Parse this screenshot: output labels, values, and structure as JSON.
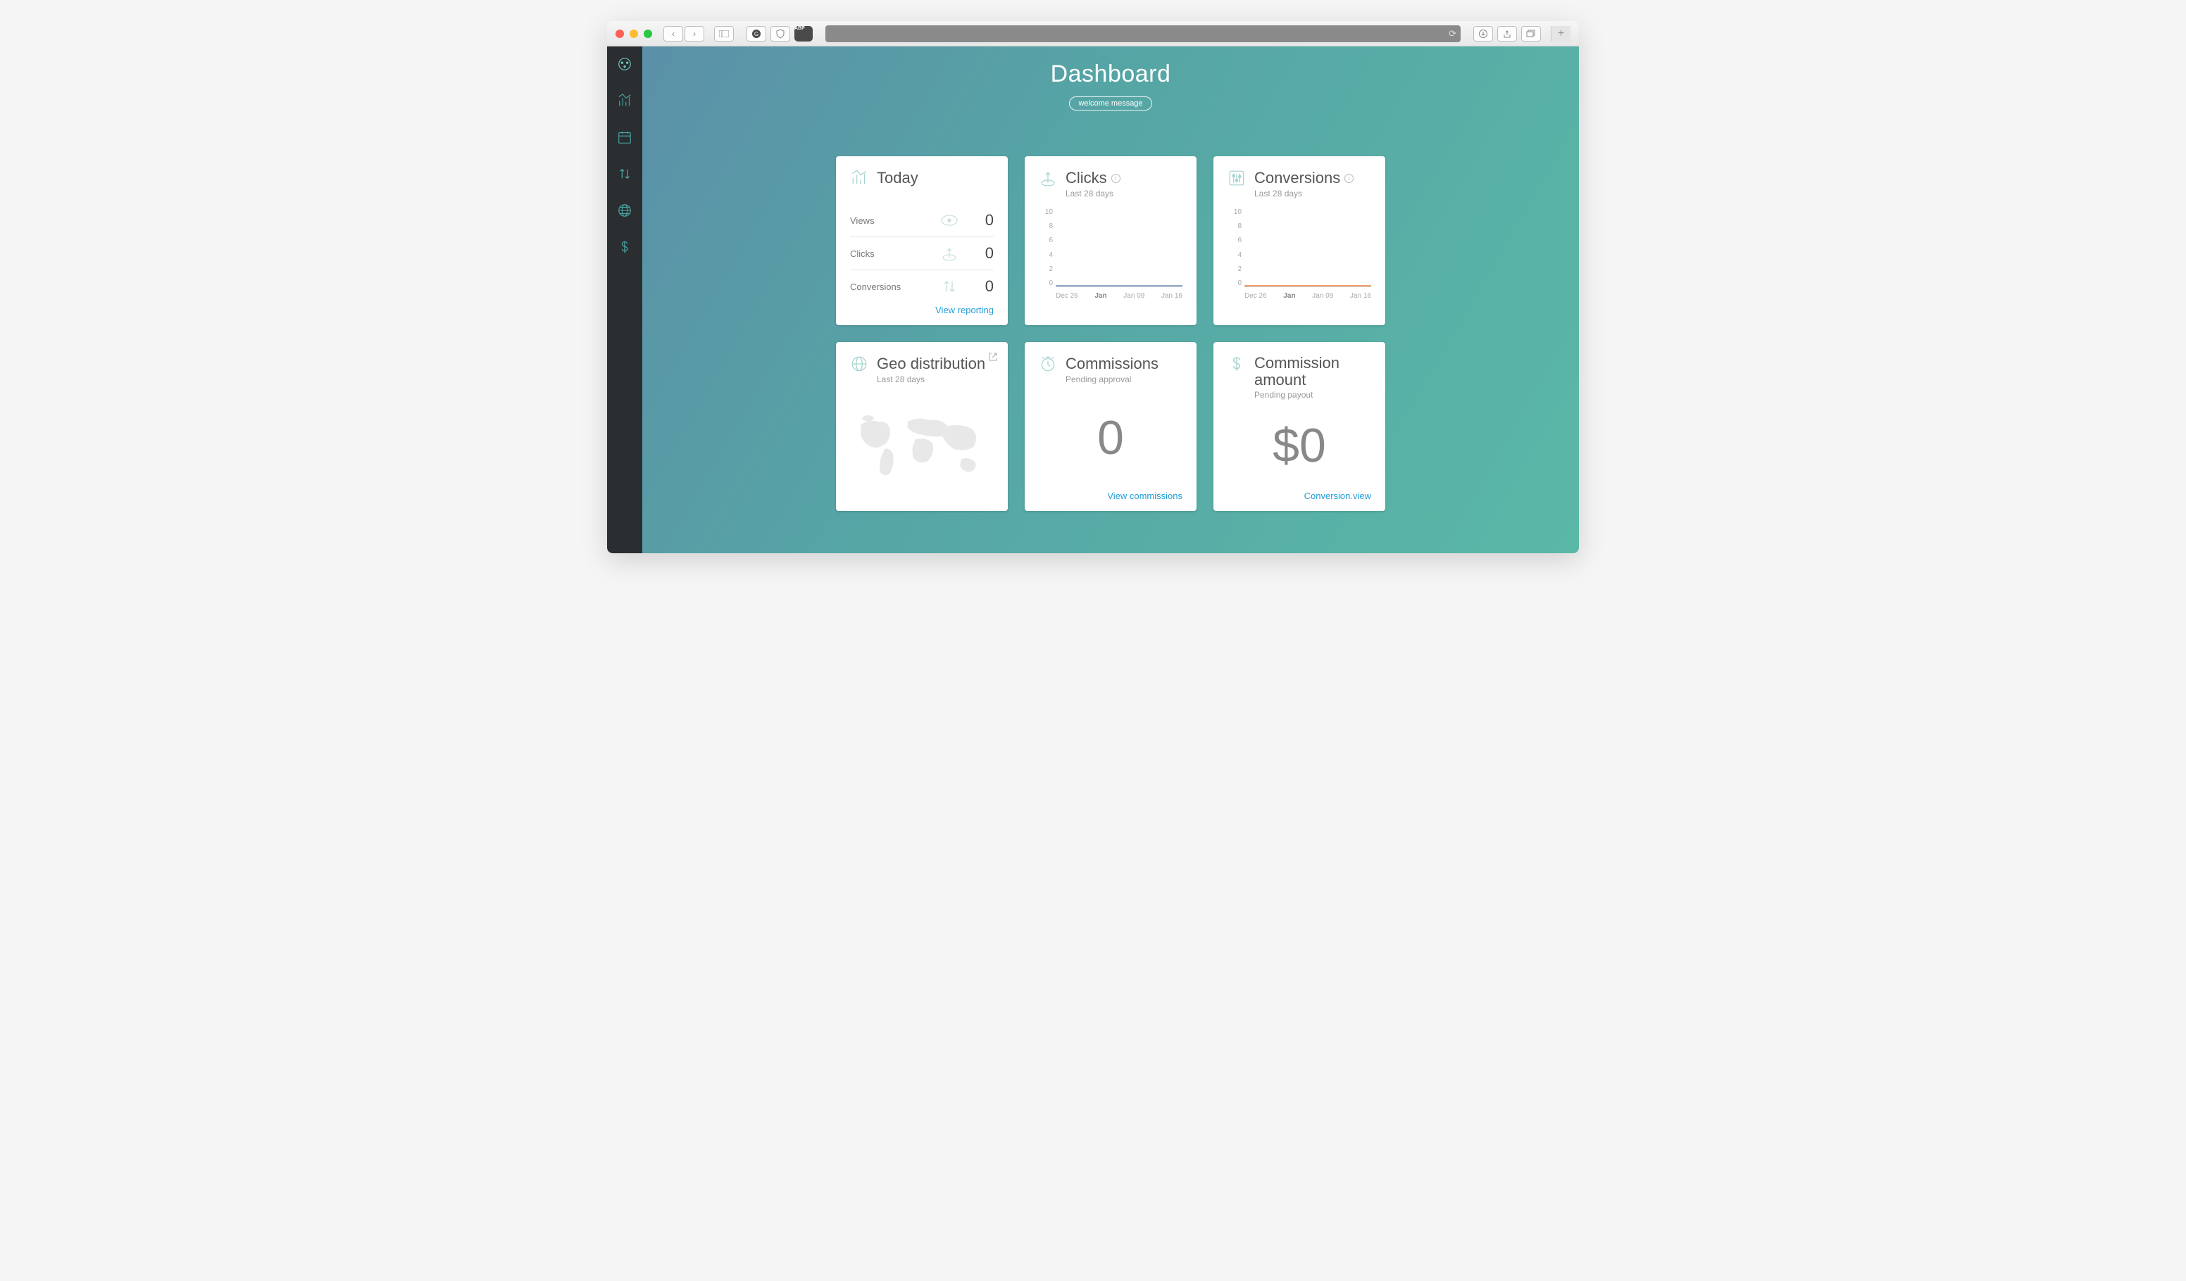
{
  "browser": {
    "traffic": [
      "close",
      "minimize",
      "maximize"
    ]
  },
  "header": {
    "title": "Dashboard",
    "subtitle_pill": "welcome message"
  },
  "sidebar": {
    "items": [
      "dashboard",
      "analytics",
      "calendar",
      "transfers",
      "globe",
      "payments"
    ]
  },
  "cards": {
    "today": {
      "title": "Today",
      "rows": [
        {
          "label": "Views",
          "value": "0"
        },
        {
          "label": "Clicks",
          "value": "0"
        },
        {
          "label": "Conversions",
          "value": "0"
        }
      ],
      "link": "View reporting"
    },
    "clicks": {
      "title": "Clicks",
      "sub": "Last 28 days"
    },
    "conversions": {
      "title": "Conversions",
      "sub": "Last 28 days"
    },
    "geo": {
      "title": "Geo distribution",
      "sub": "Last 28 days"
    },
    "commissions": {
      "title": "Commissions",
      "sub": "Pending approval",
      "value": "0",
      "link": "View commissions"
    },
    "amount": {
      "title": "Commission amount",
      "sub": "Pending payout",
      "value": "$0",
      "link": "Conversion.view"
    }
  },
  "chart_data": [
    {
      "type": "line",
      "title": "Clicks",
      "subtitle": "Last 28 days",
      "ylim": [
        0,
        10
      ],
      "y_ticks": [
        10,
        8,
        6,
        4,
        2,
        0
      ],
      "x_ticks": [
        "Dec 26",
        "Jan",
        "Jan 09",
        "Jan 16"
      ],
      "x_bold_index": 1,
      "series": [
        {
          "name": "Clicks",
          "color": "#95a8c9",
          "values": [
            0,
            0,
            0,
            0
          ]
        }
      ]
    },
    {
      "type": "line",
      "title": "Conversions",
      "subtitle": "Last 28 days",
      "ylim": [
        0,
        10
      ],
      "y_ticks": [
        10,
        8,
        6,
        4,
        2,
        0
      ],
      "x_ticks": [
        "Dec 26",
        "Jan",
        "Jan 09",
        "Jan 16"
      ],
      "x_bold_index": 1,
      "series": [
        {
          "name": "Conversions",
          "color": "#f0a070",
          "values": [
            0,
            0,
            0,
            0
          ]
        }
      ]
    }
  ]
}
